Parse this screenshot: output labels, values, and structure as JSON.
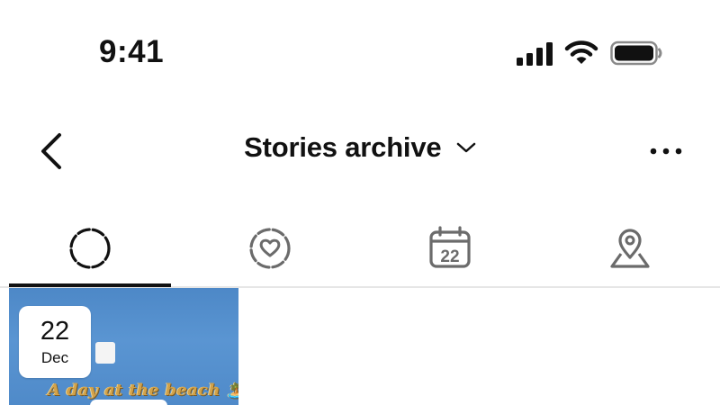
{
  "status_bar": {
    "time": "9:41",
    "icons": [
      "cellular-signal-icon",
      "wifi-icon",
      "battery-icon"
    ]
  },
  "header": {
    "title": "Stories archive",
    "back_icon": "chevron-left-icon",
    "title_dropdown_icon": "chevron-down-icon",
    "more_icon": "more-horizontal-icon"
  },
  "tabs": [
    {
      "icon": "stories-ring-icon",
      "active": true
    },
    {
      "icon": "heart-ring-icon",
      "active": false
    },
    {
      "icon": "calendar-icon",
      "label": "22",
      "active": false
    },
    {
      "icon": "location-pin-icon",
      "active": false
    }
  ],
  "stories": [
    {
      "day": "22",
      "month": "Dec",
      "caption": "A day at the beach",
      "caption_emoji": "🏝️",
      "caption_suffix": "!"
    }
  ],
  "colors": {
    "text": "#111111",
    "tab_icon": "#6b6b6b",
    "divider": "#e6e6e6",
    "tile_background": "#5a95d2"
  }
}
